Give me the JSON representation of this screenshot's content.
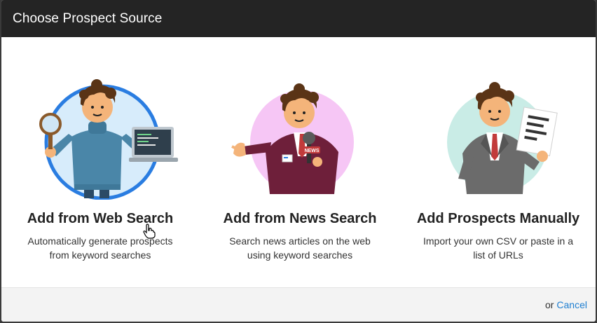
{
  "modal": {
    "title": "Choose Prospect Source"
  },
  "options": [
    {
      "title": "Add from Web Search",
      "description": "Automatically generate prospects from keyword searches",
      "circle_color": "#d7ecfb",
      "circle_border": "#2a7de1",
      "icon": "web-search-person-illustration"
    },
    {
      "title": "Add from News Search",
      "description": "Search news articles on the web using keyword searches",
      "circle_color": "#f6c6f5",
      "icon": "news-reporter-illustration"
    },
    {
      "title": "Add Prospects Manually",
      "description": "Import your own CSV or paste in a list of URLs",
      "circle_color": "#c9ece6",
      "icon": "manual-document-person-illustration"
    }
  ],
  "footer": {
    "or_text": "or",
    "cancel_label": "Cancel",
    "link_color": "#1f7fd1"
  },
  "illustration_text": {
    "news_badge": "NEWS"
  }
}
